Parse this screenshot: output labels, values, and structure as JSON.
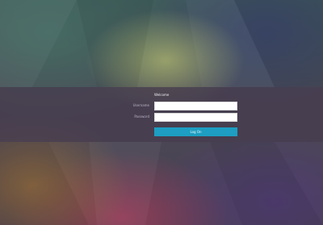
{
  "login": {
    "title": "Welcome",
    "username_label": "Username",
    "username_value": "",
    "password_label": "Password",
    "password_value": "",
    "submit_label": "Log On"
  },
  "colors": {
    "panel": "#463c4e",
    "button": "#1d9ec2",
    "input_bg": "#ffffff"
  }
}
